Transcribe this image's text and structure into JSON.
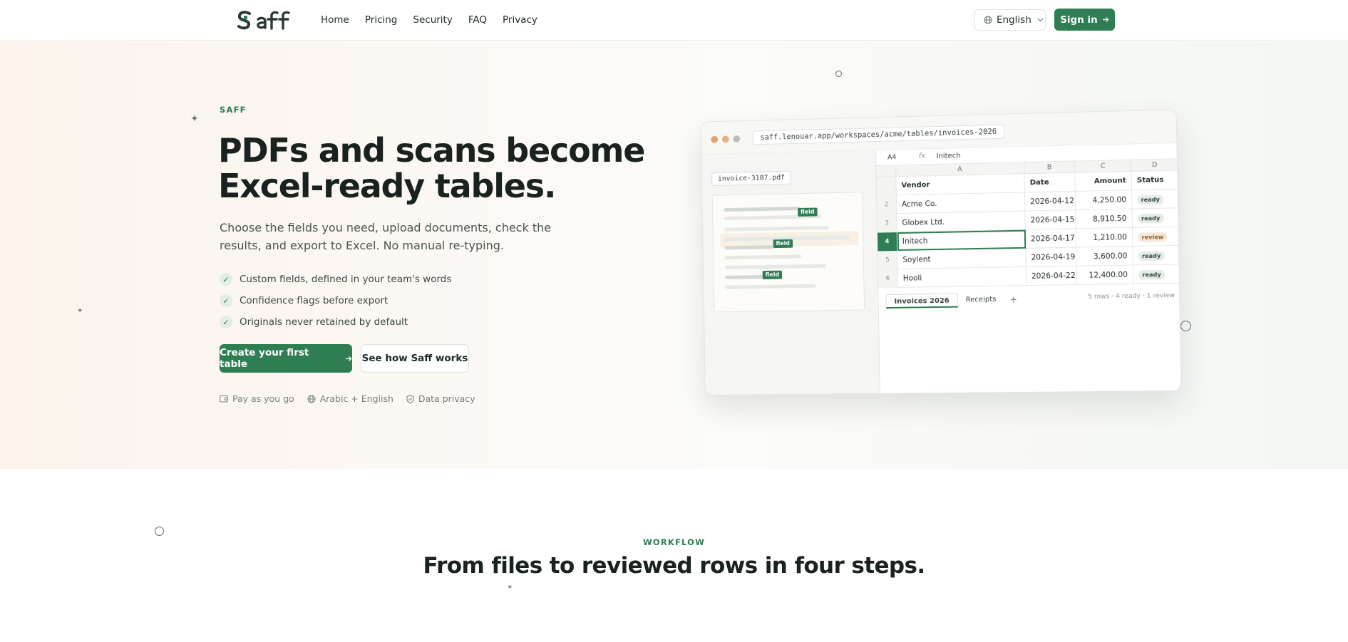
{
  "nav": {
    "logo_text": "Saff",
    "links": [
      "Home",
      "Pricing",
      "Security",
      "FAQ",
      "Privacy"
    ],
    "language": "English",
    "signin_label": "Sign in"
  },
  "hero": {
    "eyebrow": "SAFF",
    "title": "PDFs and scans become Excel-ready tables.",
    "subtitle": "Choose the fields you need, upload documents, check the results, and export to Excel. No manual re-typing.",
    "checks": [
      "Custom fields, defined in your team's words",
      "Confidence flags before export",
      "Originals never retained by default"
    ],
    "cta_primary": "Create your first table",
    "cta_secondary": "See how Saff works",
    "badges": [
      "Pay as you go",
      "Arabic + English",
      "Data privacy"
    ]
  },
  "mockup": {
    "url": "saff.lenouar.app/workspaces/acme/tables/invoices-2026",
    "filename": "invoice-3187.pdf",
    "field_tag": "field",
    "cell_ref": "A4",
    "fx_label": "fx",
    "fx_value": "Initech",
    "columns": [
      "A",
      "B",
      "C",
      "D"
    ],
    "header_row_num": "",
    "headers": [
      "Vendor",
      "Date",
      "Amount",
      "Status"
    ],
    "rows": [
      {
        "num": "2",
        "vendor": "Acme Co.",
        "date": "2026-04-12",
        "amount": "4,250.00",
        "status": "ready"
      },
      {
        "num": "3",
        "vendor": "Globex Ltd.",
        "date": "2026-04-15",
        "amount": "8,910.50",
        "status": "ready"
      },
      {
        "num": "4",
        "vendor": "Initech",
        "date": "2026-04-17",
        "amount": "1,210.00",
        "status": "review"
      },
      {
        "num": "5",
        "vendor": "Soylent",
        "date": "2026-04-19",
        "amount": "3,600.00",
        "status": "ready"
      },
      {
        "num": "6",
        "vendor": "Hooli",
        "date": "2026-04-22",
        "amount": "12,400.00",
        "status": "ready"
      }
    ],
    "tabs": [
      "Invoices 2026",
      "Receipts",
      "+"
    ],
    "sheet_status": "5 rows · 4 ready · 1 review"
  },
  "workflow": {
    "eyebrow": "WORKFLOW",
    "title": "From files to reviewed rows in four steps."
  },
  "colors": {
    "brand": "#2e7d53",
    "text": "#19221e",
    "review": "#f6e8d6"
  },
  "icons": {
    "language": "globe-icon",
    "dropdown": "chevron-down-icon",
    "arrow": "arrow-right-icon",
    "check": "check-icon",
    "wallet": "wallet-icon",
    "shield": "shield-check-icon"
  }
}
